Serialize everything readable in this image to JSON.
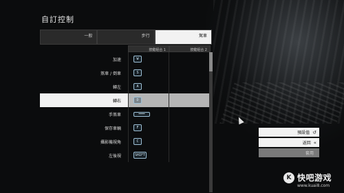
{
  "header": {
    "title": "自訂控制"
  },
  "tabs": [
    {
      "label": "一般",
      "active": false
    },
    {
      "label": "步行",
      "active": false
    },
    {
      "label": "駕車",
      "active": true
    }
  ],
  "columns": {
    "binding1": "按鍵組合 1",
    "binding2": "按鍵組合 2"
  },
  "rows": [
    {
      "label": "加速",
      "key1": "W",
      "key2": "",
      "selected": false
    },
    {
      "label": "煞車 / 倒車",
      "key1": "S",
      "key2": "",
      "selected": false
    },
    {
      "label": "轉左",
      "key1": "A",
      "key2": "",
      "selected": false
    },
    {
      "label": "轉右",
      "key1": "D",
      "key2": "",
      "selected": true
    },
    {
      "label": "手煞車",
      "key1": "━━━",
      "key2": "",
      "selected": false
    },
    {
      "label": "保存車輛",
      "key1": "F",
      "key2": "",
      "selected": false
    },
    {
      "label": "攝影機視角",
      "key1": "C",
      "key2": "",
      "selected": false
    },
    {
      "label": "左後視",
      "key1": "SHIFT",
      "key2": "",
      "selected": false
    }
  ],
  "side_buttons": [
    {
      "label": "預設值",
      "icon": "reset-icon",
      "glyph": "↺",
      "style": "light"
    },
    {
      "label": "返回",
      "icon": "back-icon",
      "glyph": "«",
      "style": "light"
    },
    {
      "label": "套用",
      "icon": "apply-icon",
      "glyph": "",
      "style": "dim"
    }
  ],
  "watermark": {
    "badge": "K",
    "name": "快吧游戏",
    "url": "www.kuai8.com"
  }
}
